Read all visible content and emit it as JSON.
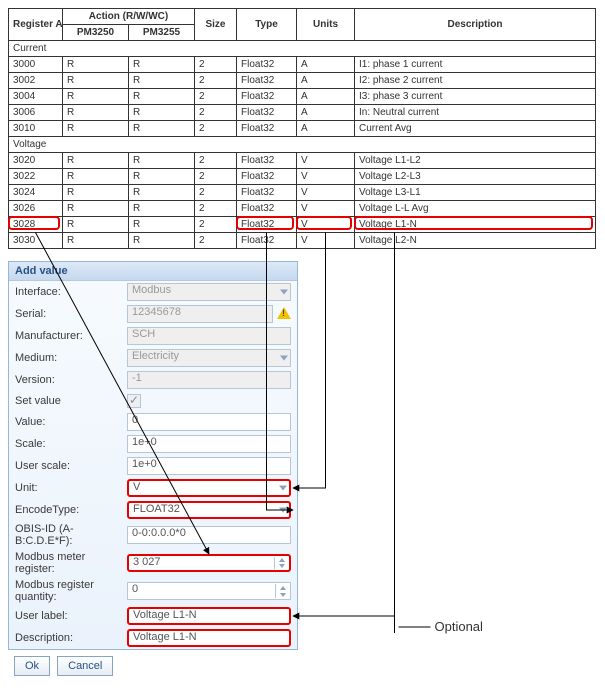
{
  "table": {
    "headers": {
      "addr": "Register Address",
      "action": "Action (R/W/WC)",
      "pm3250": "PM3250",
      "pm3255": "PM3255",
      "size": "Size",
      "type": "Type",
      "units": "Units",
      "desc": "Description"
    },
    "sections": [
      {
        "title": "Current",
        "rows": [
          {
            "addr": "3000",
            "a1": "R",
            "a2": "R",
            "size": "2",
            "type": "Float32",
            "unit": "A",
            "desc": "I1: phase 1 current"
          },
          {
            "addr": "3002",
            "a1": "R",
            "a2": "R",
            "size": "2",
            "type": "Float32",
            "unit": "A",
            "desc": "I2: phase 2 current"
          },
          {
            "addr": "3004",
            "a1": "R",
            "a2": "R",
            "size": "2",
            "type": "Float32",
            "unit": "A",
            "desc": "I3: phase 3 current"
          },
          {
            "addr": "3006",
            "a1": "R",
            "a2": "R",
            "size": "2",
            "type": "Float32",
            "unit": "A",
            "desc": "In: Neutral current"
          },
          {
            "addr": "3010",
            "a1": "R",
            "a2": "R",
            "size": "2",
            "type": "Float32",
            "unit": "A",
            "desc": "Current Avg"
          }
        ]
      },
      {
        "title": "Voltage",
        "rows": [
          {
            "addr": "3020",
            "a1": "R",
            "a2": "R",
            "size": "2",
            "type": "Float32",
            "unit": "V",
            "desc": "Voltage L1-L2"
          },
          {
            "addr": "3022",
            "a1": "R",
            "a2": "R",
            "size": "2",
            "type": "Float32",
            "unit": "V",
            "desc": "Voltage L2-L3"
          },
          {
            "addr": "3024",
            "a1": "R",
            "a2": "R",
            "size": "2",
            "type": "Float32",
            "unit": "V",
            "desc": "Voltage L3-L1"
          },
          {
            "addr": "3026",
            "a1": "R",
            "a2": "R",
            "size": "2",
            "type": "Float32",
            "unit": "V",
            "desc": "Voltage L-L Avg"
          },
          {
            "addr": "3028",
            "a1": "R",
            "a2": "R",
            "size": "2",
            "type": "Float32",
            "unit": "V",
            "desc": "Voltage L1-N"
          },
          {
            "addr": "3030",
            "a1": "R",
            "a2": "R",
            "size": "2",
            "type": "Float32",
            "unit": "V",
            "desc": "Voltage L2-N"
          }
        ]
      }
    ]
  },
  "form": {
    "title": "Add value",
    "labels": {
      "interface": "Interface:",
      "serial": "Serial:",
      "manufacturer": "Manufacturer:",
      "medium": "Medium:",
      "version": "Version:",
      "setvalue": "Set value",
      "value": "Value:",
      "scale": "Scale:",
      "userscale": "User scale:",
      "unit": "Unit:",
      "encodetype": "EncodeType:",
      "obis": "OBIS-ID (A-B:C.D.E*F):",
      "register": "Modbus meter register:",
      "quantity": "Modbus register quantity:",
      "userlabel": "User label:",
      "description": "Description:"
    },
    "values": {
      "interface": "Modbus",
      "serial": "12345678",
      "manufacturer": "SCH",
      "medium": "Electricity",
      "version": "-1",
      "value": "0",
      "scale": "1e+0",
      "userscale": "1e+0",
      "unit": "V",
      "encodetype": "FLOAT32",
      "obis": "0-0:0.0.0*0",
      "register": "3 027",
      "quantity": "0",
      "userlabel": "Voltage L1-N",
      "description": "Voltage L1-N"
    },
    "buttons": {
      "ok": "Ok",
      "cancel": "Cancel"
    }
  },
  "annotations": {
    "optional": "Optional"
  }
}
